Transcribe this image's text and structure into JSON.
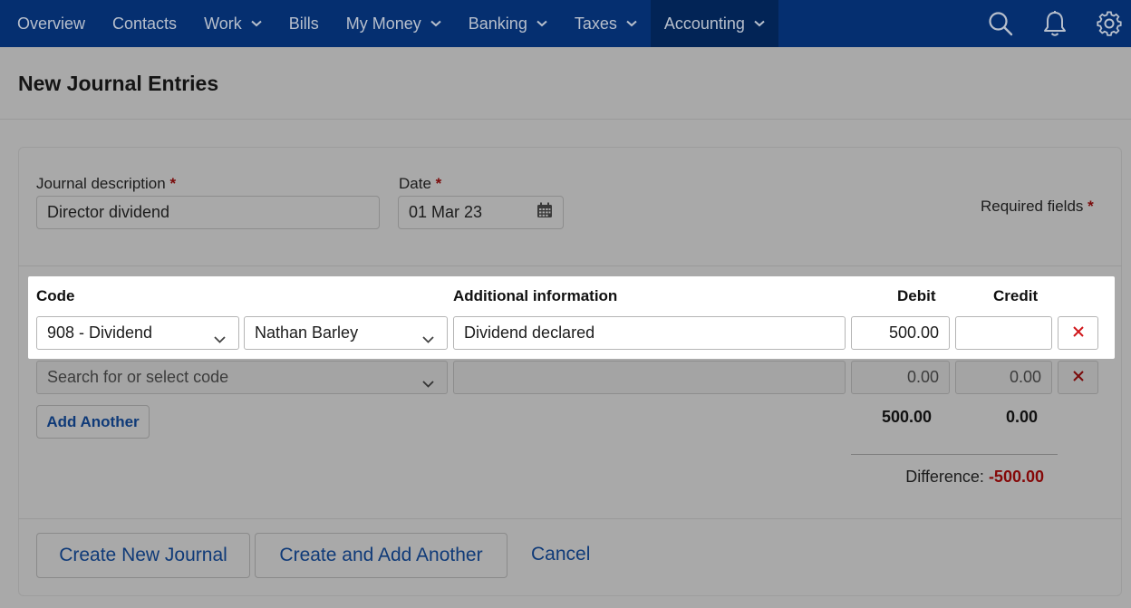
{
  "nav": {
    "items": [
      {
        "label": "Overview",
        "dropdown": false
      },
      {
        "label": "Contacts",
        "dropdown": false
      },
      {
        "label": "Work",
        "dropdown": true
      },
      {
        "label": "Bills",
        "dropdown": false
      },
      {
        "label": "My Money",
        "dropdown": true
      },
      {
        "label": "Banking",
        "dropdown": true
      },
      {
        "label": "Taxes",
        "dropdown": true
      },
      {
        "label": "Accounting",
        "dropdown": true,
        "active": true
      }
    ],
    "icons": [
      "search-icon",
      "bell-icon",
      "gear-icon"
    ],
    "background": "#052f70"
  },
  "page": {
    "title": "New Journal Entries"
  },
  "form": {
    "description_label": "Journal description",
    "description_value": "Director dividend",
    "date_label": "Date",
    "date_value": "01 Mar 23",
    "required_star": "*",
    "required_note": "Required fields"
  },
  "table": {
    "headers": {
      "code": "Code",
      "info": "Additional information",
      "debit": "Debit",
      "credit": "Credit"
    },
    "rows": [
      {
        "code": "908 - Dividend",
        "contact": "Nathan Barley",
        "info": "Dividend declared",
        "debit": "500.00",
        "credit": ""
      },
      {
        "code_placeholder": "Search for or select code",
        "info": "",
        "debit_placeholder": "0.00",
        "credit_placeholder": "0.00"
      }
    ],
    "add_another_label": "Add Another",
    "total_debit": "500.00",
    "total_credit": "0.00",
    "difference_label": "Difference:",
    "difference_value": "-500.00"
  },
  "actions": {
    "create_label": "Create New Journal",
    "create_add_label": "Create and Add Another",
    "cancel_label": "Cancel"
  },
  "colors": {
    "accent": "#0f3a78",
    "danger": "#d0171b"
  }
}
